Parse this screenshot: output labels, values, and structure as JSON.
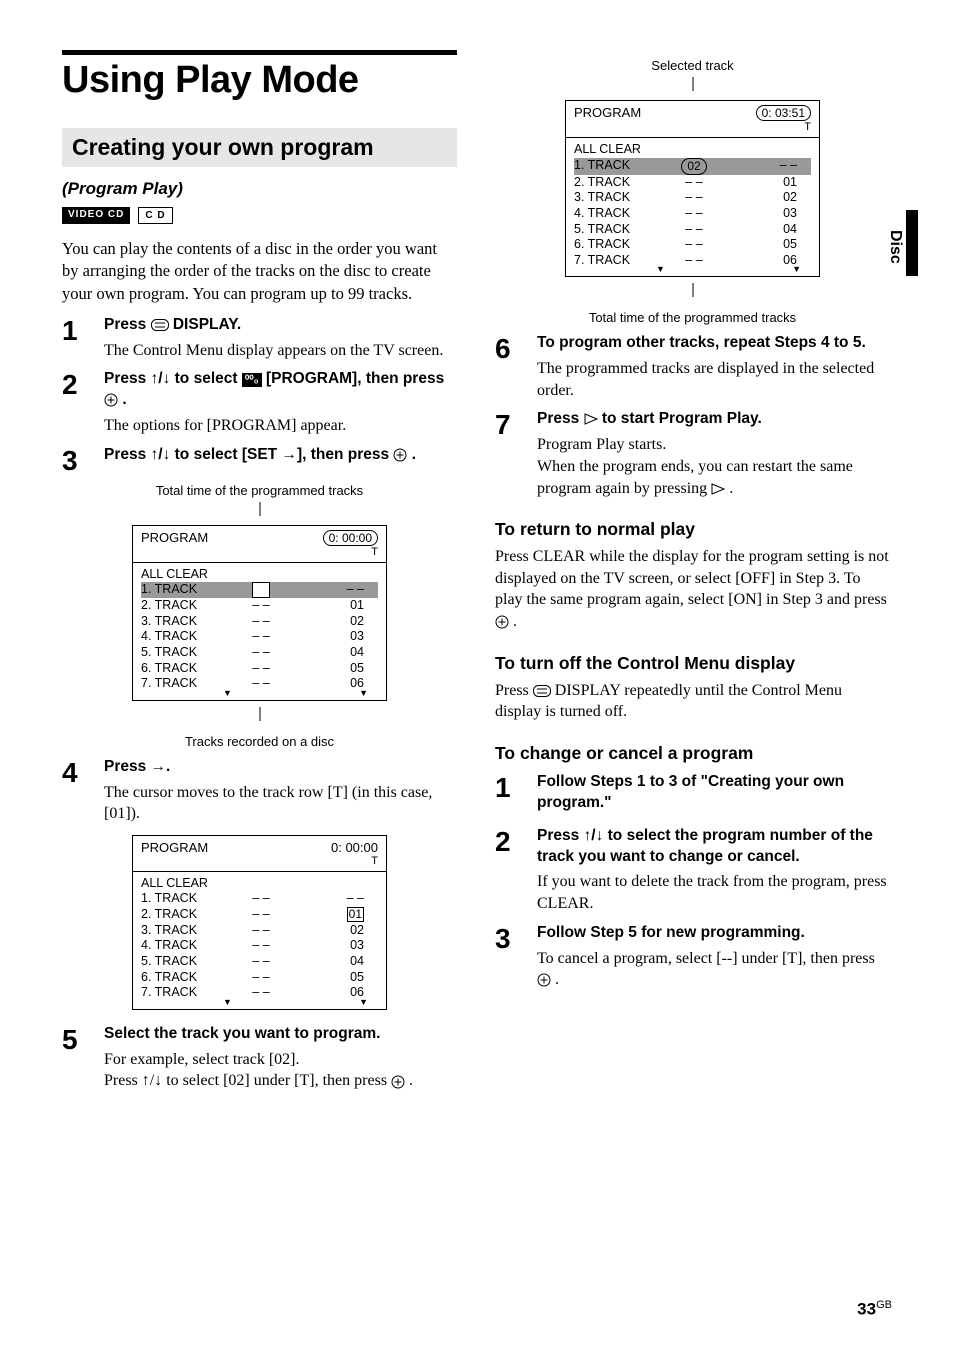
{
  "main_title": "Using Play Mode",
  "section_title": "Creating your own program",
  "subtitle": "(Program Play)",
  "badges": {
    "video_cd": "VIDEO CD",
    "cd": "C D"
  },
  "intro": "You can play the contents of a disc in the order you want by arranging the order of the tracks on the disc to create your own program. You can program up to 99 tracks.",
  "steps_left": [
    {
      "n": "1",
      "head_a": "Press ",
      "head_b": " DISPLAY.",
      "desc": "The Control Menu display appears on the TV screen."
    },
    {
      "n": "2",
      "head_a": "Press ↑/↓ to select ",
      "head_b": " [PROGRAM], then press ",
      "head_c": " .",
      "desc": "The options for [PROGRAM] appear."
    },
    {
      "n": "3",
      "head_a": "Press ↑/↓ to select [SET →], then press ",
      "head_b": " .",
      "desc": ""
    },
    {
      "n": "4",
      "head_a": "Press →.",
      "desc": "The cursor moves to the track row [T] (in this case, [01])."
    },
    {
      "n": "5",
      "head_a": "Select the track you want to program.",
      "desc1": "For example, select track [02].",
      "desc2": "Press ↑/↓ to select [02] under [T], then press ",
      "desc3": " ."
    }
  ],
  "caption_total_time": "Total time of the programmed tracks",
  "caption_tracks_recorded": "Tracks recorded on a disc",
  "caption_selected_track": "Selected track",
  "caption_total_time2": "Total time of the programmed tracks",
  "osd_common": {
    "program": "PROGRAM",
    "all_clear": "ALL CLEAR",
    "t": "T",
    "tracks": [
      "1. TRACK",
      "2. TRACK",
      "3. TRACK",
      "4. TRACK",
      "5. TRACK",
      "6. TRACK",
      "7. TRACK"
    ],
    "dashes": "– –",
    "right_col": [
      "– –",
      "01",
      "02",
      "03",
      "04",
      "05",
      "06"
    ]
  },
  "osd1_time": "0: 00:00",
  "osd2_time": "0: 00:00",
  "osd3_time": "0: 03:51",
  "osd3_sel": "02",
  "steps_right": [
    {
      "n": "6",
      "head": "To program other tracks, repeat Steps 4 to 5.",
      "desc": "The programmed tracks are displayed in the selected order."
    },
    {
      "n": "7",
      "head_a": "Press ",
      "head_b": " to start Program Play.",
      "desc1": "Program Play starts.",
      "desc2": "When the program ends, you can restart the same program again by pressing ",
      "desc3": "."
    }
  ],
  "h3_return": "To return to normal play",
  "p_return": "Press CLEAR while the display for the program setting is not displayed on the TV screen, or select [OFF] in Step 3. To play the same program again, select [ON] in Step 3 and press ",
  "p_return_end": " .",
  "h3_turnoff": "To turn off the Control Menu display",
  "p_turnoff_a": "Press ",
  "p_turnoff_b": " DISPLAY repeatedly until the Control Menu display is turned off.",
  "h3_change": "To change or cancel a program",
  "change_steps": [
    {
      "n": "1",
      "head": "Follow Steps 1 to 3 of \"Creating your own program.\""
    },
    {
      "n": "2",
      "head": "Press ↑/↓ to select the program number of the track you want to change or cancel.",
      "desc": "If you want to delete the track from the program, press CLEAR."
    },
    {
      "n": "3",
      "head": "Follow Step 5 for new programming.",
      "desc_a": "To cancel a program, select [--] under [T], then press ",
      "desc_b": " ."
    }
  ],
  "side_label": "Disc",
  "page_num": "33",
  "page_suffix": "GB"
}
